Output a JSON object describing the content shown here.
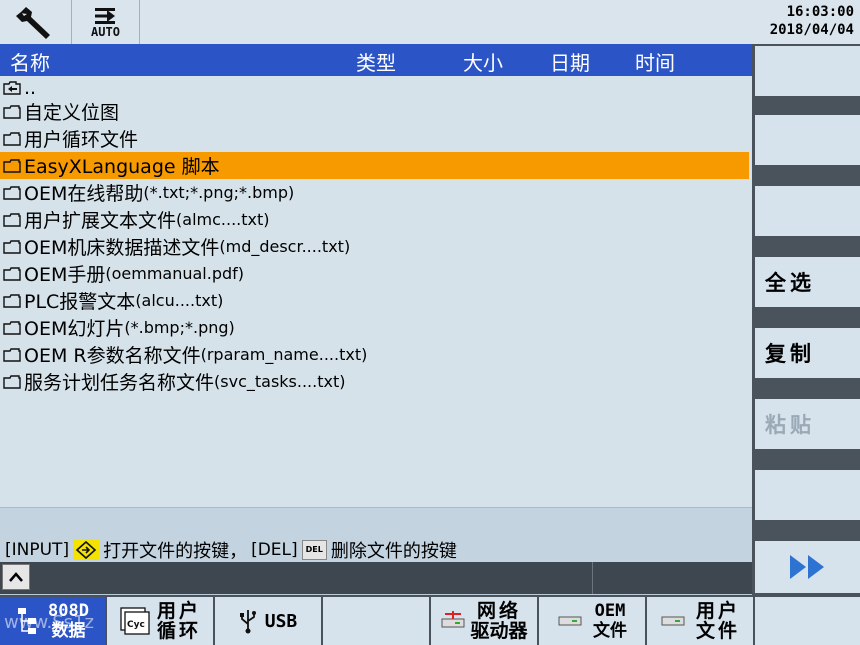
{
  "topbar": {
    "mode_label": "AUTO",
    "time": "16:03:00",
    "date": "2018/04/04"
  },
  "table": {
    "columns": [
      "名称",
      "类型",
      "大小",
      "日期",
      "时间"
    ],
    "up_label": "..",
    "rows": [
      {
        "name": "自定义位图",
        "hint": ""
      },
      {
        "name": "用户循环文件",
        "hint": ""
      },
      {
        "name": "EasyXLanguage 脚本",
        "hint": "",
        "selected": true
      },
      {
        "name": "OEM在线帮助",
        "hint": " (*.txt;*.png;*.bmp)"
      },
      {
        "name": "用户扩展文本文件",
        "hint": " (almc....txt)"
      },
      {
        "name": "OEM机床数据描述文件",
        "hint": " (md_descr....txt)"
      },
      {
        "name": "OEM手册",
        "hint": " (oemmanual.pdf)"
      },
      {
        "name": "PLC报警文本",
        "hint": " (alcu....txt)"
      },
      {
        "name": "OEM幻灯片",
        "hint": " (*.bmp;*.png)"
      },
      {
        "name": "OEM R参数名称文件",
        "hint": " (rparam_name....txt)"
      },
      {
        "name": "服务计划任务名称文件",
        "hint": " (svc_tasks....txt)"
      }
    ]
  },
  "message": {
    "input_key": "[INPUT]",
    "input_text": "打开文件的按键，",
    "del_key": "[DEL]",
    "del_icon_text": "DEL",
    "del_text": "删除文件的按键"
  },
  "softkeys_right": {
    "select_all": "全选",
    "copy": "复制",
    "paste": "粘贴"
  },
  "softkeys_bottom": {
    "data_line1": "808D",
    "data_line2": "数据",
    "cycles_line1": "用户",
    "cycles_line2": "循环",
    "cycles_icon_text": "Cyc",
    "usb": "USB",
    "net_line1": "网络",
    "net_line2": "驱动器",
    "oem_line1": "OEM",
    "oem_line2": "文件",
    "user_line1": "用户",
    "user_line2": "文件"
  },
  "watermark": "www.Ss1z"
}
